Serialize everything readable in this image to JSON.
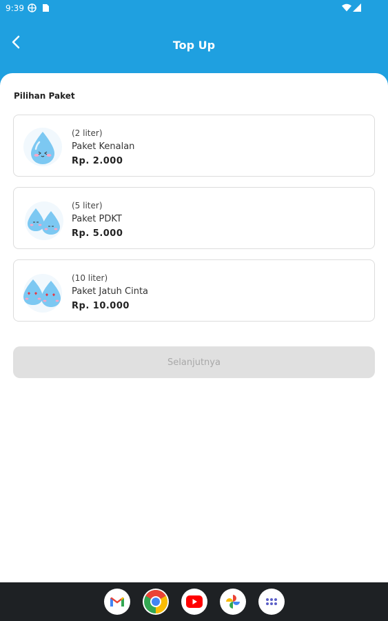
{
  "status_bar": {
    "time": "9:39",
    "icons": [
      "vpn-icon",
      "sim-card-icon",
      "wifi-icon",
      "signal-icon"
    ]
  },
  "header": {
    "title": "Top Up",
    "back_icon": "chevron-left-icon"
  },
  "section": {
    "title": "Pilihan Paket"
  },
  "packages": [
    {
      "volume": "(2 liter)",
      "name": "Paket Kenalan",
      "price": "Rp. 2.000",
      "icon": "single-water-drop-icon"
    },
    {
      "volume": "(5 liter)",
      "name": "Paket PDKT",
      "price": "Rp. 5.000",
      "icon": "two-water-drops-icon"
    },
    {
      "volume": "(10 liter)",
      "name": "Paket Jatuh Cinta",
      "price": "Rp. 10.000",
      "icon": "two-water-drops-love-icon"
    }
  ],
  "next_button": {
    "label": "Selanjutnya",
    "enabled": false
  },
  "dock": {
    "apps": [
      "gmail-icon",
      "chrome-icon",
      "youtube-icon",
      "photos-icon",
      "app-drawer-icon"
    ]
  },
  "colors": {
    "primary": "#1fa0e0",
    "card_border": "#dcdcdc",
    "disabled_button": "#e0e0e0",
    "drop_fill": "#7cc8f2",
    "nav_bar": "#1e2124"
  }
}
